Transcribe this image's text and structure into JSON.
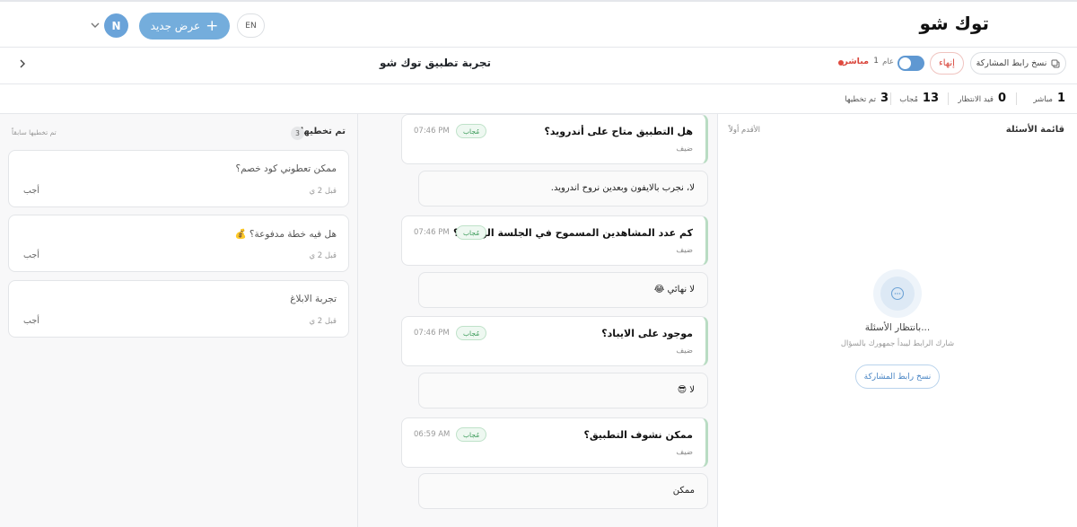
{
  "header": {
    "brand": "توك شو",
    "new_show_label": "عرض جديد",
    "lang_label": "EN",
    "avatar_initial": "N"
  },
  "subheader": {
    "title": "تجربة تطبيق توك شو",
    "copy_link_label": "نسخ رابط المشاركة",
    "end_label": "إنهاء",
    "public_label": "عام",
    "live_count": "1",
    "live_label": "مباشر"
  },
  "stats": [
    {
      "value": "1",
      "label": "مباشر"
    },
    {
      "value": "0",
      "label": "قيد الانتظار"
    },
    {
      "value": "13",
      "label": "مُجاب"
    },
    {
      "value": "3",
      "label": "تم تخطيها"
    }
  ],
  "queue": {
    "title": "قائمة الأسئلة",
    "sort_label": "الأقدم أولاً",
    "empty_title": "بانتظار الأسئلة...",
    "empty_subtitle": "شارك الرابط ليبدأ جمهورك بالسؤال",
    "copy_link_label": "نسخ رابط المشاركة"
  },
  "answered": {
    "items": [
      {
        "question": "هل التطبيق متاح على أندرويد؟",
        "author": "ضيف",
        "badge": "مُجاب",
        "time": "07:46 PM",
        "answer": "لا، نجرب بالايفون وبعدين نروح اندرويد."
      },
      {
        "question": "كم عدد المشاهدين المسموح في الجلسة الواحدة؟",
        "author": "ضيف",
        "badge": "مُجاب",
        "time": "07:46 PM",
        "answer": "لا نهائي 😂"
      },
      {
        "question": "موجود على الايباد؟",
        "author": "ضيف",
        "badge": "مُجاب",
        "time": "07:46 PM",
        "answer": "لا 😎"
      },
      {
        "question": "ممكن نشوف التطبيق؟",
        "author": "ضيف",
        "badge": "مُجاب",
        "time": "06:59 AM",
        "answer": "ممكن"
      }
    ]
  },
  "skipped": {
    "title": "تم تخطيها",
    "count": "3",
    "previously_label": "تم تخطيها سابقاً",
    "items": [
      {
        "question": "ممكن تعطوني كود خصم؟",
        "ago": "قبل 2 ي",
        "answer_label": "أجب"
      },
      {
        "question": "هل فيه خطة مدفوعة؟ 💰",
        "ago": "قبل 2 ي",
        "answer_label": "أجب"
      },
      {
        "question": "تجربة الابلاغ",
        "ago": "قبل 2 ي",
        "answer_label": "أجب"
      }
    ]
  },
  "colors": {
    "accent": "#74addc",
    "live_red": "#e04a3f",
    "answered_green": "#3a9a58"
  }
}
